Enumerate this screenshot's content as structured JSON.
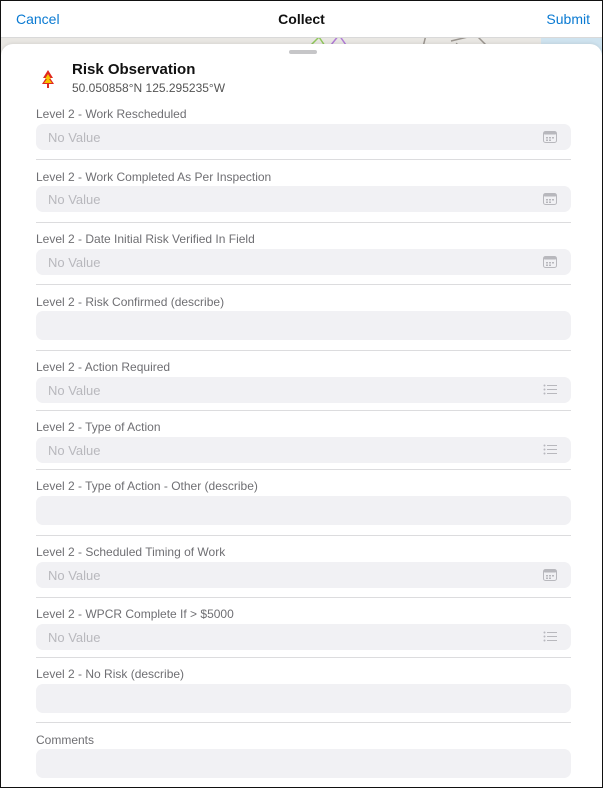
{
  "nav": {
    "cancel": "Cancel",
    "title": "Collect",
    "submit": "Submit"
  },
  "feature": {
    "icon": "tree-marker-icon",
    "title": "Risk Observation",
    "coords": "50.050858°N  125.295235°W"
  },
  "fields": [
    {
      "label": "Level 2 - Work Rescheduled",
      "value": "No Value",
      "icon": "calendar-icon"
    },
    {
      "label": "Level 2 - Work Completed As Per Inspection",
      "value": "No Value",
      "icon": "calendar-icon"
    },
    {
      "label": "Level 2 - Date Initial Risk Verified In Field",
      "value": "No Value",
      "icon": "calendar-icon"
    },
    {
      "label": "Level 2 - Risk Confirmed (describe)",
      "value": "",
      "icon": ""
    },
    {
      "label": "Level 2 - Action Required",
      "value": "No Value",
      "icon": "list-icon"
    },
    {
      "label": "Level 2 - Type of Action",
      "value": "No Value",
      "icon": "list-icon"
    },
    {
      "label": "Level 2 - Type of Action - Other (describe)",
      "value": "",
      "icon": ""
    },
    {
      "label": "Level 2 - Scheduled Timing of Work",
      "value": "No Value",
      "icon": "calendar-icon"
    },
    {
      "label": "Level 2 - WPCR Complete If > $5000",
      "value": "No Value",
      "icon": "list-icon"
    },
    {
      "label": "Level 2 - No Risk (describe)",
      "value": "",
      "icon": ""
    },
    {
      "label": "Comments",
      "value": "",
      "icon": ""
    }
  ],
  "colors": {
    "accent": "#0a7ad2",
    "input_bg": "#f1f1f4",
    "label": "#6f6f73",
    "placeholder": "#b8b8bd",
    "marker_red": "#e0281f",
    "marker_yellow": "#f5c400"
  }
}
